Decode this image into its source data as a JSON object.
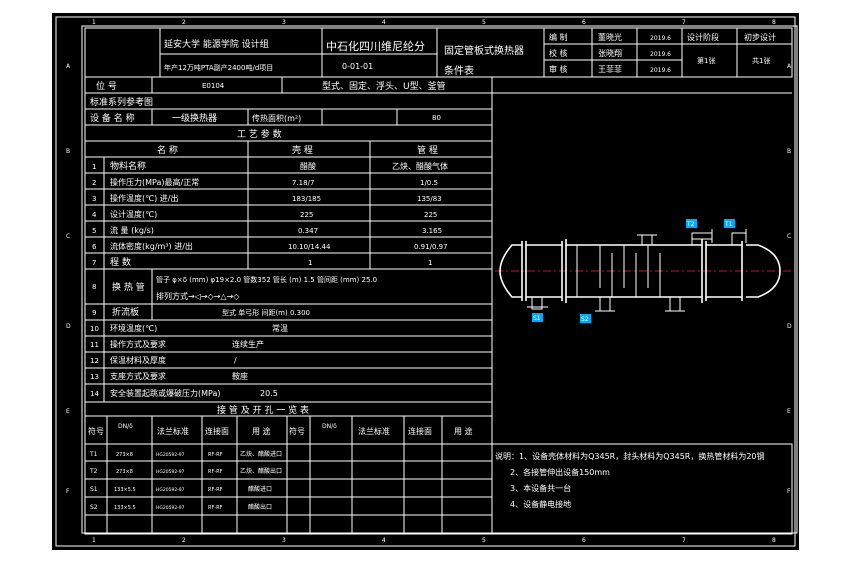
{
  "border": {
    "col_numbers": [
      "1",
      "2",
      "3",
      "4",
      "5",
      "6",
      "7",
      "8"
    ],
    "row_letters": [
      "A",
      "B",
      "C",
      "D",
      "E",
      "F"
    ]
  },
  "title_block": {
    "school": "延安大学 能源学院 设计组",
    "project": "中石化四川维尼纶分",
    "project_line2": "年产12万吨PTA副产2400吨/d项目",
    "drawing_no": "0-01-01",
    "drawing_name_l1": "固定管板式换热器",
    "drawing_name_l2": "条件表",
    "roles": [
      {
        "role": "编 制",
        "name": "董晓光",
        "date": "2019.6"
      },
      {
        "role": "校 核",
        "name": "张晓翔",
        "date": "2019.6"
      },
      {
        "role": "审 核",
        "name": "王菲菲",
        "date": "2019.6"
      }
    ],
    "stage_label": "设计阶段",
    "stage_value": "初步设计",
    "sheet_no": "第1张",
    "sheet_total": "共1张"
  },
  "spec": {
    "position_label": "位 号",
    "position_value": "E0104",
    "type_text": "型式、固定、浮头、U型、釜管",
    "standard_label": "标准系列参考图",
    "equipment_label": "设 备 名 称",
    "equipment_value": "一级换热器",
    "area_label": "传热面积(m²)",
    "area_value": "80",
    "process_title": "工 艺 参 数",
    "head_item": "名 称",
    "head_shell": "壳 程",
    "head_tube": "管 程",
    "rows": [
      {
        "no": "1",
        "name": "物料名称",
        "shell": "醋酸",
        "tube": "乙炔、醋酸气体"
      },
      {
        "no": "2",
        "name": "操作压力(MPa)最高/正常",
        "shell": "7.18/7",
        "tube": "1/0.5"
      },
      {
        "no": "3",
        "name": "操作温度(℃) 进/出",
        "shell": "183/185",
        "tube": "135/83"
      },
      {
        "no": "4",
        "name": "设计温度(℃)",
        "shell": "225",
        "tube": "225"
      },
      {
        "no": "5",
        "name": "流 量 (kg/s)",
        "shell": "0.347",
        "tube": "3.165"
      },
      {
        "no": "6",
        "name": "流体密度(kg/m³) 进/出",
        "shell": "10.10/14.44",
        "tube": "0.91/0.97"
      },
      {
        "no": "7",
        "name": "程 数",
        "shell": "1",
        "tube": "1"
      }
    ],
    "row8_no": "8",
    "row8_label": "换 热 管",
    "row8_line1": "管子 φ×δ (mm) φ19×2.0  管数352  管长 (m) 1.5  管间距 (mm) 25.0",
    "row8_line2": "排列方式→◁→◇→△→◇",
    "row9_no": "9",
    "row9_label": "折流板",
    "row9_value": "型式 单弓形    间距(m) 0.300",
    "rows_other": [
      {
        "no": "10",
        "name": "环境温度(℃)",
        "value": "常温"
      },
      {
        "no": "11",
        "name": "操作方式及要求",
        "value": "连续生产"
      },
      {
        "no": "12",
        "name": "保温材料及厚度",
        "value": "/"
      },
      {
        "no": "13",
        "name": "支座方式及要求",
        "value": "鞍座"
      },
      {
        "no": "14",
        "name": "安全装置起跳或爆破压力(MPa)",
        "value": "20.5"
      }
    ]
  },
  "nozzles": {
    "title": "接 管 及 开 孔 一 览 表",
    "headers": [
      "符号",
      "DN/δ",
      "法兰标准",
      "连接面",
      "用 途",
      "符号",
      "DN/δ",
      "法兰标准",
      "连接面",
      "用 途"
    ],
    "rows": [
      {
        "sym": "T1",
        "dn": "273×8",
        "std": "HG20592-97",
        "face": "RF-RF",
        "use": "乙炔、醋酸进口"
      },
      {
        "sym": "T2",
        "dn": "273×8",
        "std": "HG20592-97",
        "face": "RF-RF",
        "use": "乙炔、醋酸出口"
      },
      {
        "sym": "S1",
        "dn": "133×5.5",
        "std": "HG20592-97",
        "face": "RF-RF",
        "use": "醋酸进口"
      },
      {
        "sym": "S2",
        "dn": "133×5.5",
        "std": "HG20592-97",
        "face": "RF-RF",
        "use": "醋酸出口"
      }
    ]
  },
  "notes": [
    "说明：1、设备壳体材料为Q345R，封头材料为Q345R，换热管材料为20钢",
    "2、各接管伸出设备150mm",
    "3、本设备共一台",
    "4、设备静电接地"
  ],
  "diagram_tags": [
    "S1",
    "T2",
    "T1",
    "S2"
  ]
}
